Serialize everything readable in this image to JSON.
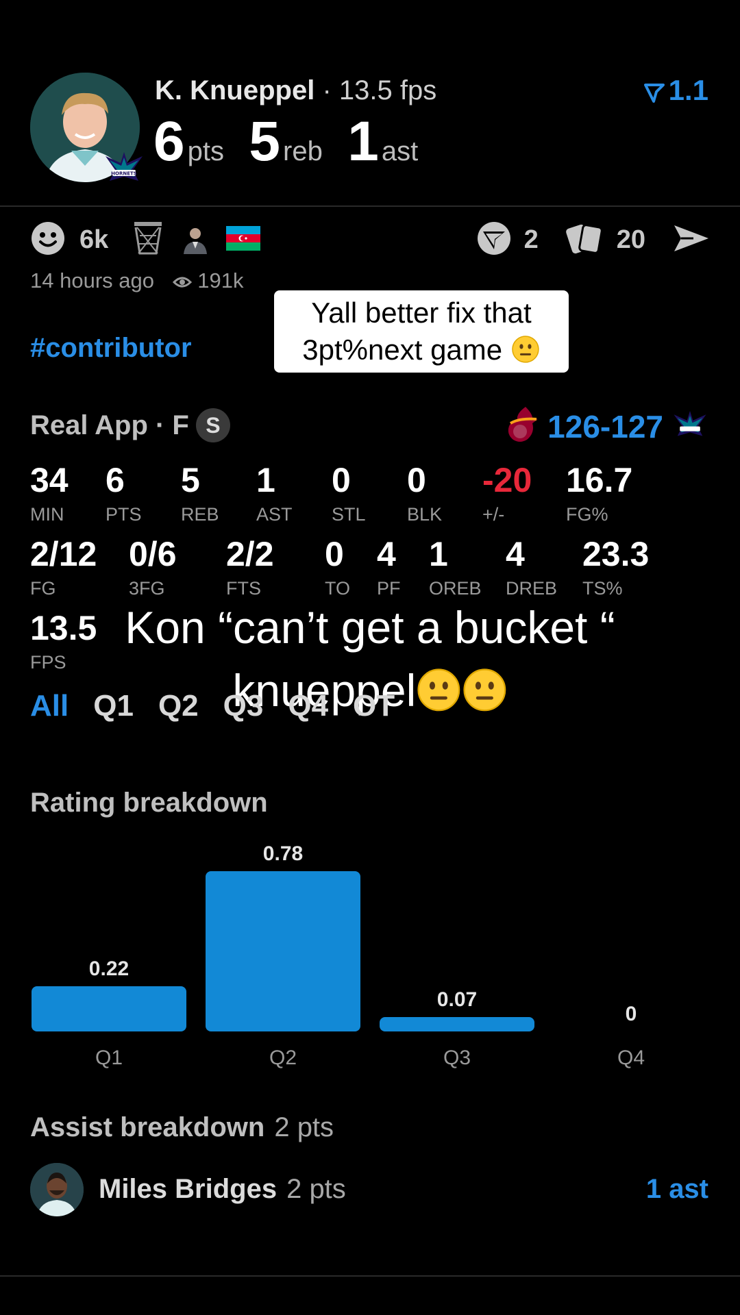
{
  "header": {
    "player_name": "K. Knueppel",
    "separator": "·",
    "fps": "13.5 fps",
    "statline": [
      {
        "value": "6",
        "unit": "pts"
      },
      {
        "value": "5",
        "unit": "reb"
      },
      {
        "value": "1",
        "unit": "ast"
      }
    ],
    "rating": "1.1"
  },
  "actions": {
    "reactions_count": "6k",
    "comments_count": "2",
    "cards_count": "20"
  },
  "meta": {
    "time_ago": "14 hours ago",
    "views": "191k",
    "hashtag": "#contributor"
  },
  "comment_bubble": {
    "line1": "Yall better fix that",
    "line2": "3pt%next game"
  },
  "game": {
    "app_label": "Real App · F",
    "s_badge": "S",
    "score": "126-127"
  },
  "stats_row1": [
    {
      "value": "34",
      "label": "MIN"
    },
    {
      "value": "6",
      "label": "PTS"
    },
    {
      "value": "5",
      "label": "REB"
    },
    {
      "value": "1",
      "label": "AST"
    },
    {
      "value": "0",
      "label": "STL"
    },
    {
      "value": "0",
      "label": "BLK"
    },
    {
      "value": "-20",
      "label": "+/-",
      "negative": true
    },
    {
      "value": "16.7",
      "label": "FG%"
    }
  ],
  "stats_row2": [
    {
      "value": "2/12",
      "label": "FG"
    },
    {
      "value": "0/6",
      "label": "3FG"
    },
    {
      "value": "2/2",
      "label": "FTS"
    },
    {
      "value": "0",
      "label": "TO"
    },
    {
      "value": "4",
      "label": "PF"
    },
    {
      "value": "1",
      "label": "OREB"
    },
    {
      "value": "4",
      "label": "DREB"
    },
    {
      "value": "23.3",
      "label": "TS%"
    }
  ],
  "stats_row3": [
    {
      "value": "13.5",
      "label": "FPS"
    }
  ],
  "overlay_caption": {
    "line1": "Kon “can’t get a bucket “",
    "line2": "knueppel"
  },
  "tabs": [
    "All",
    "Q1",
    "Q2",
    "Q3",
    "Q4",
    "OT"
  ],
  "rating_breakdown_title": "Rating breakdown",
  "chart_data": {
    "type": "bar",
    "categories": [
      "Q1",
      "Q2",
      "Q3",
      "Q4"
    ],
    "values": [
      0.22,
      0.78,
      0.07,
      0
    ],
    "data_labels": [
      "0.22",
      "0.78",
      "0.07",
      "0"
    ],
    "bar_color": "#1289d6",
    "ylim": [
      0,
      0.78
    ],
    "grid": false
  },
  "assist": {
    "title": "Assist breakdown",
    "title_pts": "2 pts",
    "player_name": "Miles Bridges",
    "player_pts": "2 pts",
    "count": "1 ast"
  },
  "colors": {
    "accent": "#2a8ee6",
    "negative": "#e8283a",
    "background": "#000000"
  }
}
